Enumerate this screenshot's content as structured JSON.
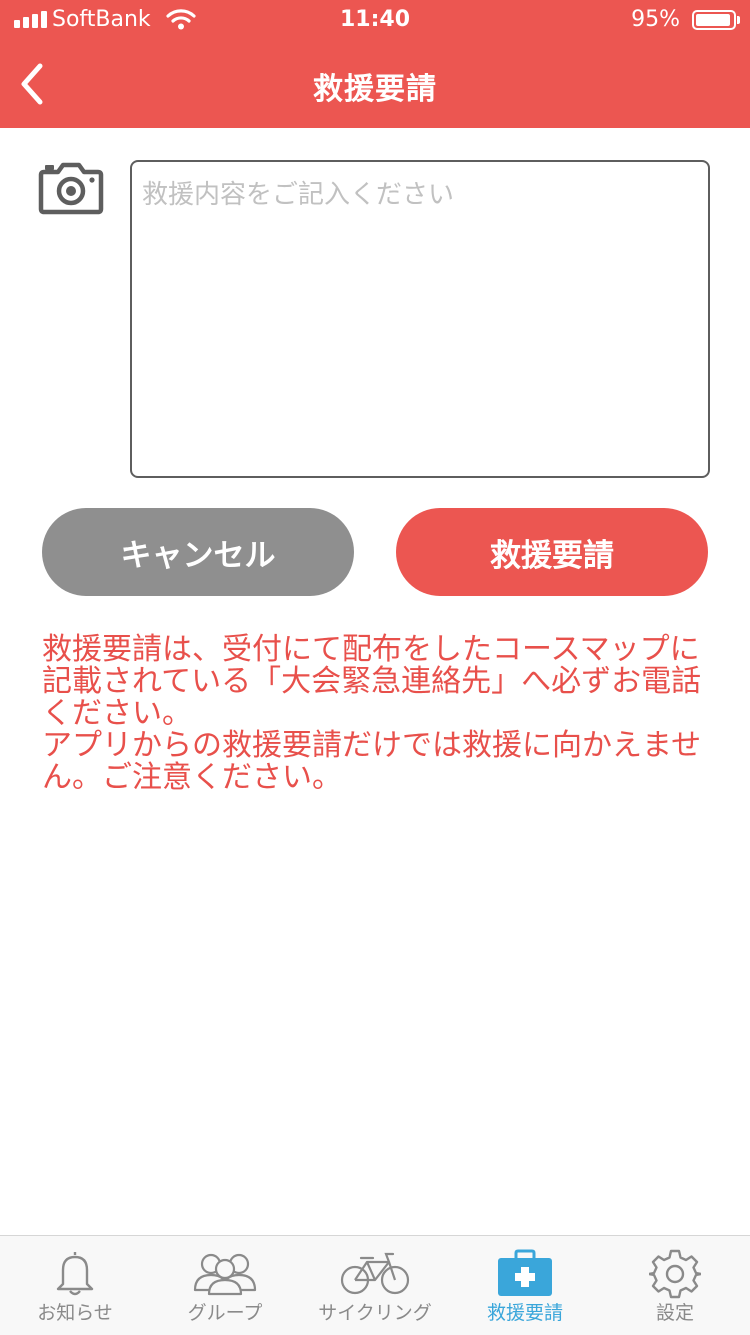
{
  "status_bar": {
    "carrier": "SoftBank",
    "time": "11:40",
    "battery_percent": "95%",
    "battery_level": 0.95,
    "signal_bars": 4
  },
  "header": {
    "title": "救援要請",
    "back_icon": "chevron-left-icon"
  },
  "form": {
    "camera_icon": "camera-icon",
    "message_placeholder": "救援内容をご記入ください",
    "message_value": ""
  },
  "buttons": {
    "cancel_label": "キャンセル",
    "submit_label": "救援要請"
  },
  "notice": {
    "paragraph1": "救援要請は、受付にて配布をしたコースマップに記載されている「大会緊急連絡先」へ必ずお電話ください。",
    "paragraph2": "アプリからの救援要請だけでは救援に向かえません。ご注意ください。"
  },
  "tabbar": {
    "active_index": 3,
    "items": [
      {
        "label": "お知らせ",
        "icon": "bell-icon"
      },
      {
        "label": "グループ",
        "icon": "group-icon"
      },
      {
        "label": "サイクリング",
        "icon": "bicycle-icon"
      },
      {
        "label": "救援要請",
        "icon": "first-aid-kit-icon"
      },
      {
        "label": "設定",
        "icon": "gear-icon"
      }
    ]
  },
  "colors": {
    "primary_red": "#ec5651",
    "notice_red": "#e8504b",
    "cancel_gray": "#8f8f8f",
    "tab_active_blue": "#3aa6da",
    "tab_inactive_gray": "#8a8a8a"
  }
}
